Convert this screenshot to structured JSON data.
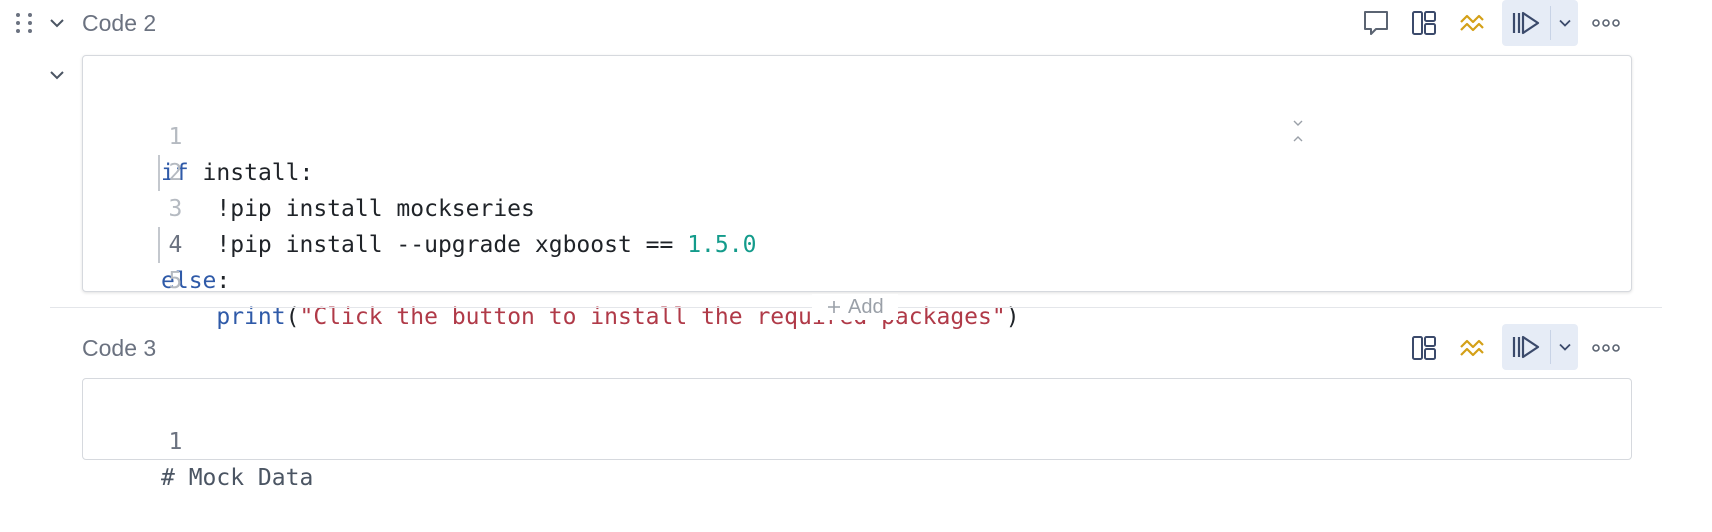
{
  "cells": [
    {
      "title": "Code 2",
      "icons": {
        "comment": "comment-icon",
        "layout": "layout-panel-icon",
        "ai": "ai-assist-icon",
        "run": "run-cell-icon",
        "run_dropdown": "chevron-down-icon",
        "more": "more-options-icon"
      },
      "code_lines": [
        {
          "num": "1",
          "parts": [
            {
              "t": "if",
              "c": "kw"
            },
            {
              "t": " install:",
              "c": ""
            }
          ]
        },
        {
          "num": "2",
          "parts": [
            {
              "t": "    !pip install mockseries",
              "c": ""
            }
          ]
        },
        {
          "num": "3",
          "parts": [
            {
              "t": "    !pip install --upgrade xgboost == ",
              "c": ""
            },
            {
              "t": "1.5.0",
              "c": "num"
            }
          ]
        },
        {
          "num": "4",
          "parts": [
            {
              "t": "else",
              "c": "kw"
            },
            {
              "t": ":",
              "c": ""
            }
          ]
        },
        {
          "num": "5",
          "parts": [
            {
              "t": "    ",
              "c": ""
            },
            {
              "t": "print",
              "c": "fn"
            },
            {
              "t": "(",
              "c": ""
            },
            {
              "t": "\"Click the button to install the required packages\"",
              "c": "str"
            },
            {
              "t": ")",
              "c": ""
            }
          ]
        }
      ]
    },
    {
      "title": "Code 3",
      "code_lines": [
        {
          "num": "1",
          "parts": [
            {
              "t": "# Mock Data",
              "c": ""
            }
          ]
        }
      ]
    }
  ],
  "add_label": "Add",
  "colors": {
    "keyword": "#2f5aa8",
    "number": "#139b8b",
    "string": "#b03a48",
    "ai_icon": "#d4a017",
    "run_bg": "#e6ecf6"
  }
}
